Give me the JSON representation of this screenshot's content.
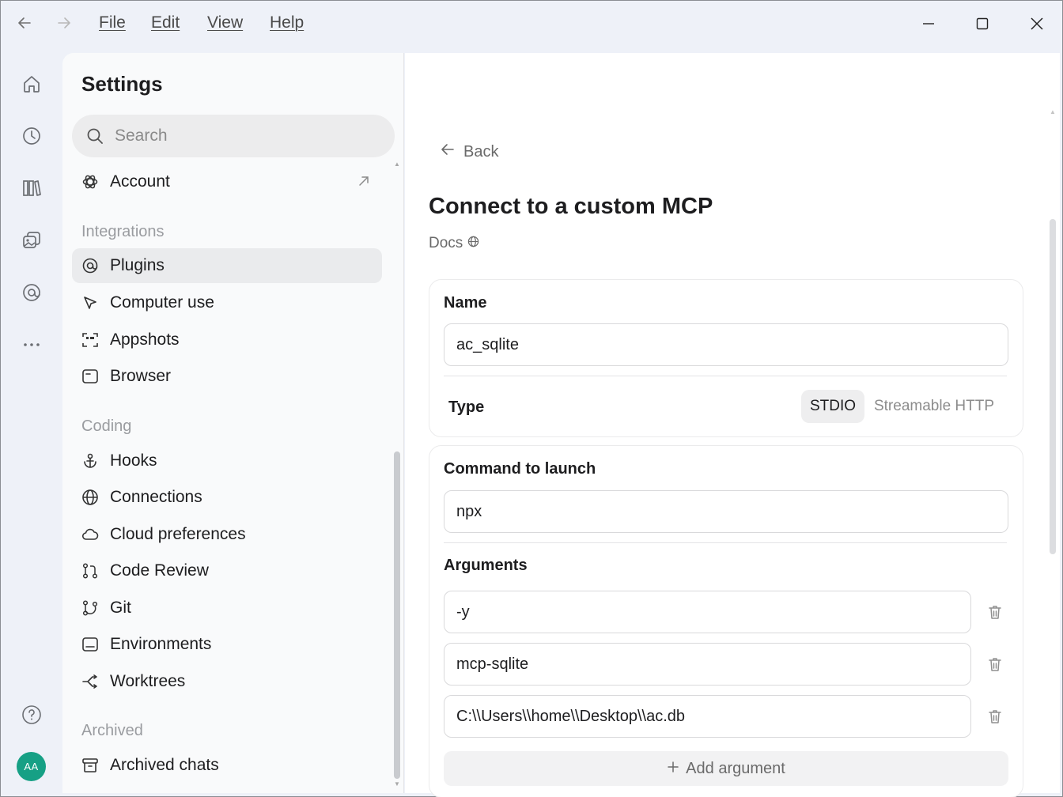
{
  "menu": {
    "file": "File",
    "edit": "Edit",
    "view": "View",
    "help": "Help"
  },
  "avatar": {
    "initials": "AA",
    "color": "#16a085"
  },
  "settings": {
    "title": "Settings",
    "search_placeholder": "Search",
    "account": "Account",
    "sections": {
      "integrations": "Integrations",
      "coding": "Coding",
      "archived": "Archived"
    },
    "items": {
      "plugins": "Plugins",
      "computer_use": "Computer use",
      "appshots": "Appshots",
      "browser": "Browser",
      "hooks": "Hooks",
      "connections": "Connections",
      "cloud_preferences": "Cloud preferences",
      "code_review": "Code Review",
      "git": "Git",
      "environments": "Environments",
      "worktrees": "Worktrees",
      "archived_chats": "Archived chats"
    },
    "active_item": "Plugins"
  },
  "main": {
    "back": "Back",
    "title": "Connect to a custom MCP",
    "docs": "Docs",
    "name_label": "Name",
    "name_value": "ac_sqlite",
    "type_label": "Type",
    "type_options": [
      "STDIO",
      "Streamable HTTP"
    ],
    "type_selected": "STDIO",
    "command_label": "Command to launch",
    "command_value": "npx",
    "arguments_label": "Arguments",
    "arguments": [
      "-y",
      "mcp-sqlite",
      "C:\\\\Users\\\\home\\\\Desktop\\\\ac.db"
    ],
    "add_argument": "Add argument"
  }
}
